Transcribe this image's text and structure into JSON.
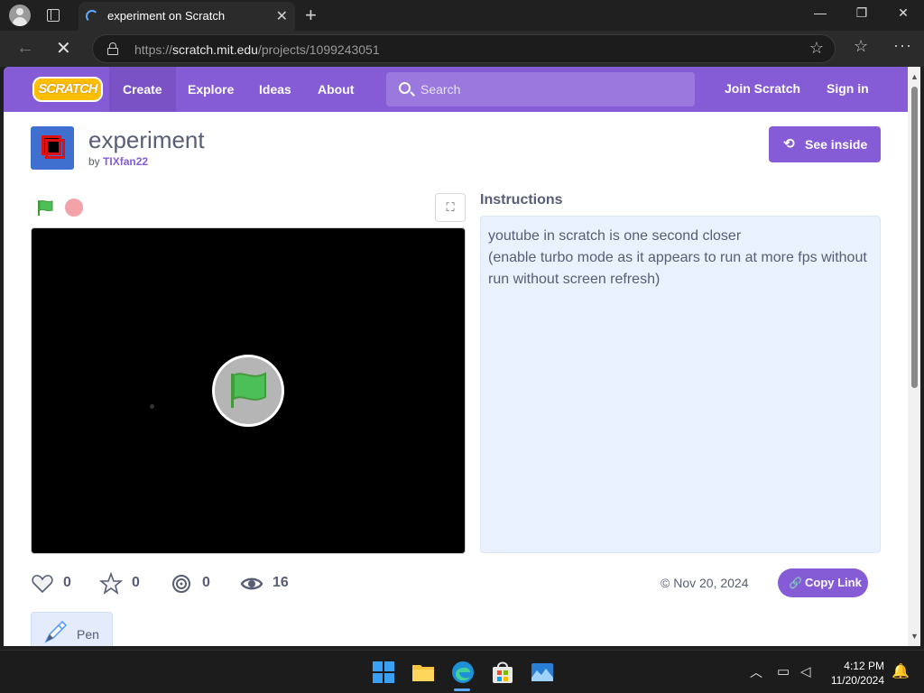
{
  "browser": {
    "tab_title": "experiment on Scratch",
    "url_prefix": "https://",
    "url_host": "scratch.mit.edu",
    "url_path": "/projects/1099243051",
    "window_minimize": "—",
    "window_restore": "❐",
    "window_close": "✕",
    "tab_close": "✕",
    "new_tab": "+",
    "back_glyph": "←",
    "stop_glyph": "✕"
  },
  "nav": {
    "logo_text": "SCRATCH",
    "items": [
      {
        "label": "Create"
      },
      {
        "label": "Explore"
      },
      {
        "label": "Ideas"
      },
      {
        "label": "About"
      }
    ],
    "search_placeholder": "Search",
    "join": "Join Scratch",
    "signin": "Sign in",
    "accent_color": "#855cd6"
  },
  "project": {
    "title": "experiment",
    "by_prefix": "by",
    "author": "TIXfan22",
    "see_inside": "See inside",
    "instructions_heading": "Instructions",
    "instructions_lines": [
      "youtube in scratch is one second closer",
      "(enable turbo mode as it appears to run at more fps without run without screen refresh)"
    ],
    "stats": {
      "loves": "0",
      "favorites": "0",
      "remixes": "0",
      "views": "16"
    },
    "date": "Nov 20, 2024",
    "copy_link": "Copy Link",
    "tag": "Pen"
  },
  "taskbar": {
    "time": "4:12 PM",
    "date": "11/20/2024",
    "apps": [
      "windows-start-icon",
      "file-explorer-icon",
      "edge-icon",
      "store-icon",
      "photos-icon"
    ]
  }
}
